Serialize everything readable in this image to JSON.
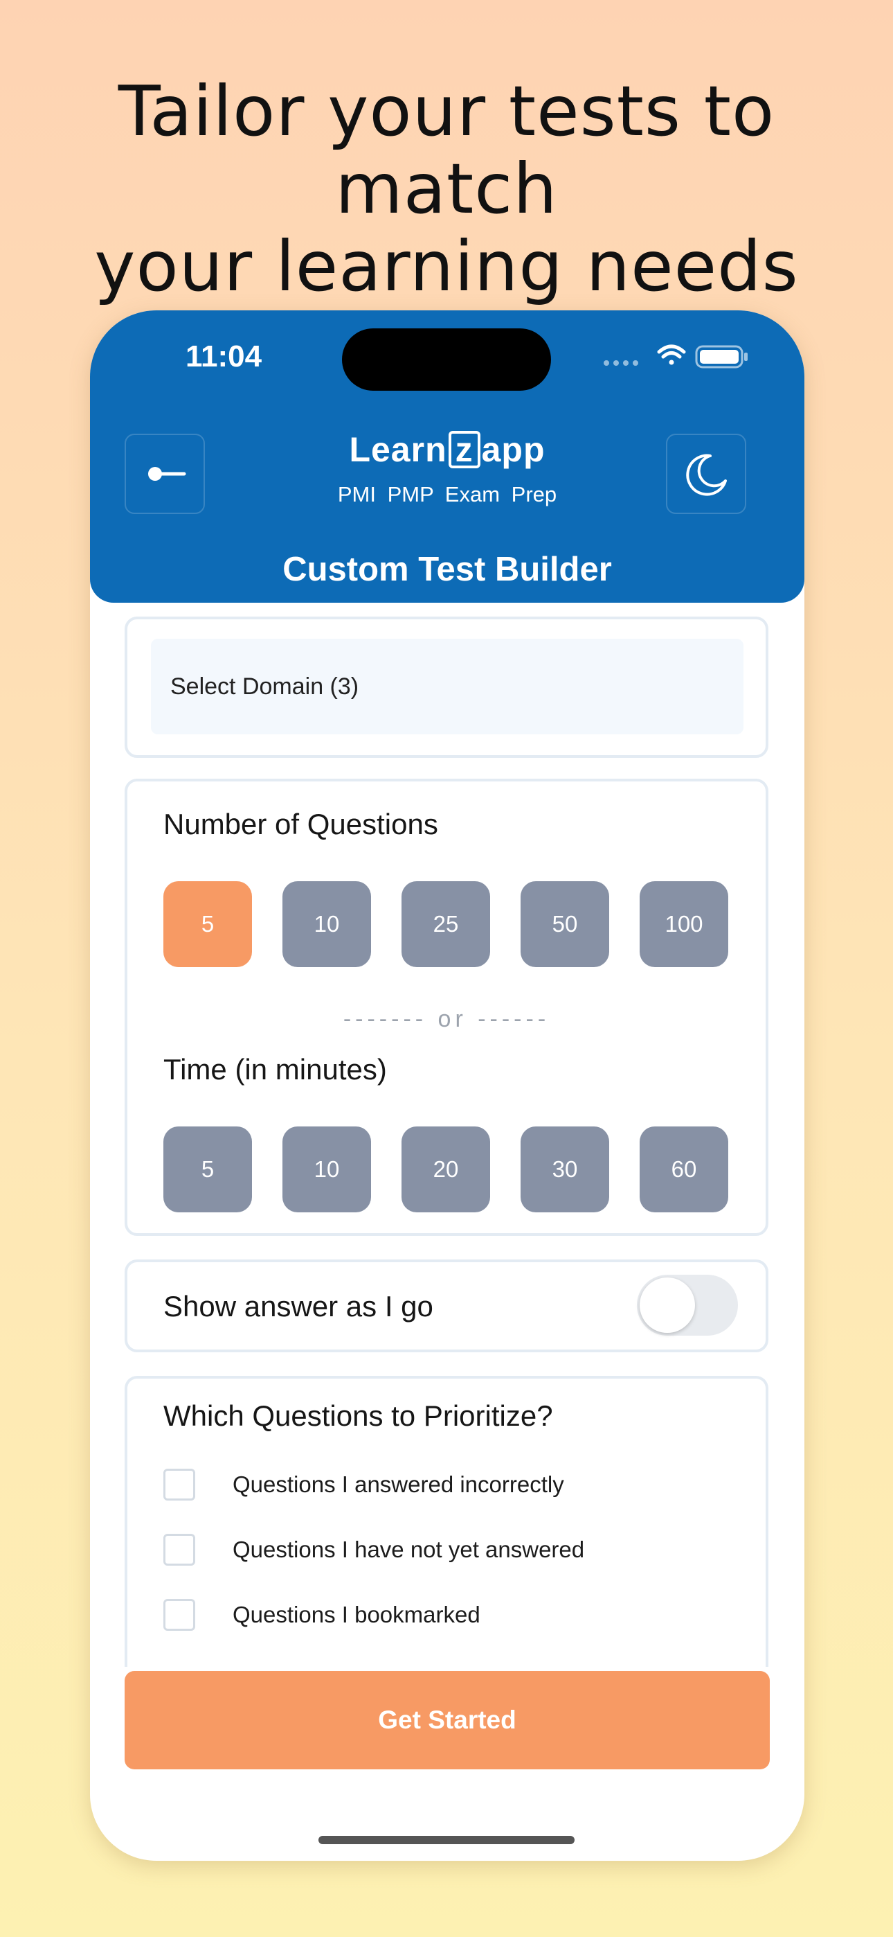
{
  "headline": {
    "line1": "Tailor your tests to match",
    "line2": "your learning needs"
  },
  "status_bar": {
    "time": "11:04"
  },
  "header": {
    "logo_left": "Learn",
    "logo_mid": "z",
    "logo_right": "app",
    "subtitle": "PMI PMP Exam Prep",
    "title": "Custom Test Builder",
    "back_icon": "back-arrow-icon",
    "theme_icon": "moon-icon",
    "color": "#0d6bb6"
  },
  "domain_select": {
    "label": "Select Domain (3)"
  },
  "questions": {
    "title": "Number of Questions",
    "options": [
      "5",
      "10",
      "25",
      "50",
      "100"
    ],
    "selected": "5"
  },
  "divider": {
    "label": "------- or ------"
  },
  "time": {
    "title": "Time (in minutes)",
    "options": [
      "5",
      "10",
      "20",
      "30",
      "60"
    ]
  },
  "show_answer": {
    "label": "Show answer as I go",
    "enabled": false
  },
  "prioritize": {
    "title": "Which Questions to Prioritize?",
    "items": [
      "Questions I answered incorrectly",
      "Questions I have not yet answered",
      "Questions I bookmarked"
    ]
  },
  "cta": {
    "label": "Get Started",
    "color": "#f79a64"
  },
  "colors": {
    "chip_inactive": "#8791a5",
    "chip_active": "#f79a64"
  }
}
